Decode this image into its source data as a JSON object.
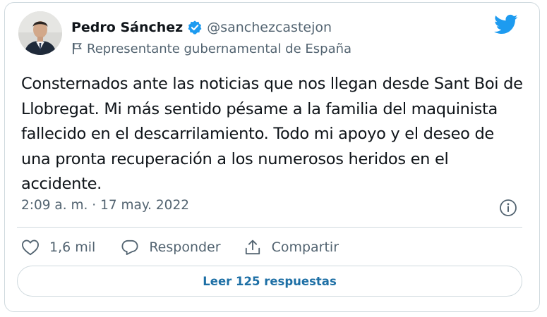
{
  "author": {
    "display_name": "Pedro Sánchez",
    "handle": "@sanchezcastejon",
    "verified": true,
    "label": "Representante gubernamental de España",
    "label_icon": "flag-icon",
    "avatar_icon": "avatar-photo"
  },
  "brand": {
    "logo_icon": "twitter-bird-icon",
    "accent_color": "#1d9bf0"
  },
  "tweet": {
    "text": "Consternados ante las noticias que nos llegan desde Sant Boi de Llobregat. Mi más sentido pésame a la familia del maquinista fallecido en el descarrilamiento. Todo mi apoyo y el deseo de una pronta recuperación a los numerosos heridos en el accidente.",
    "timestamp": "2:09 a. m. · 17 may. 2022"
  },
  "actions": {
    "like_count": "1,6 mil",
    "reply_label": "Responder",
    "share_label": "Compartir"
  },
  "footer": {
    "read_replies_label": "Leer 125 respuestas"
  },
  "colors": {
    "text_primary": "#0f1419",
    "text_secondary": "#536471",
    "border": "#cfd9de",
    "link": "#1d6fa5"
  }
}
